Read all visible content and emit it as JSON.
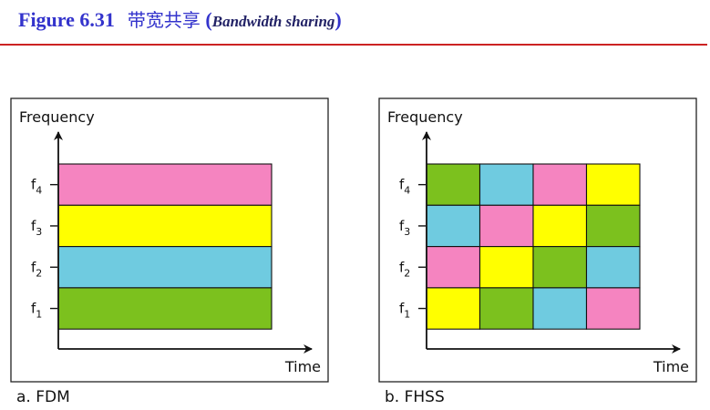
{
  "title": {
    "figure": "Figure 6.31",
    "chinese": "带宽共享",
    "open_paren": "(",
    "english": "Bandwidth sharing",
    "close_paren": ")"
  },
  "colors": {
    "pink": "#f584c0",
    "yellow": "#ffff00",
    "blue": "#6fcbe0",
    "green": "#7cc11e",
    "title": "#3333cc",
    "rule": "#cc2222"
  },
  "panels": [
    {
      "id": "fdm",
      "caption": "a. FDM",
      "y_axis_label": "Frequency",
      "x_axis_label": "Time",
      "channels": [
        {
          "base": "f",
          "sub": "4"
        },
        {
          "base": "f",
          "sub": "3"
        },
        {
          "base": "f",
          "sub": "2"
        },
        {
          "base": "f",
          "sub": "1"
        }
      ],
      "columns": 1,
      "grid": [
        [
          "pink"
        ],
        [
          "yellow"
        ],
        [
          "blue"
        ],
        [
          "green"
        ]
      ]
    },
    {
      "id": "fhss",
      "caption": "b. FHSS",
      "y_axis_label": "Frequency",
      "x_axis_label": "Time",
      "channels": [
        {
          "base": "f",
          "sub": "4"
        },
        {
          "base": "f",
          "sub": "3"
        },
        {
          "base": "f",
          "sub": "2"
        },
        {
          "base": "f",
          "sub": "1"
        }
      ],
      "columns": 4,
      "grid": [
        [
          "green",
          "blue",
          "pink",
          "yellow"
        ],
        [
          "blue",
          "pink",
          "yellow",
          "green"
        ],
        [
          "pink",
          "yellow",
          "green",
          "blue"
        ],
        [
          "yellow",
          "green",
          "blue",
          "pink"
        ]
      ]
    }
  ]
}
